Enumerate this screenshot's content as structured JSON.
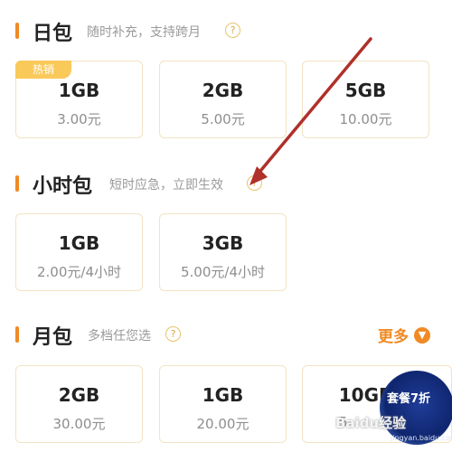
{
  "daily": {
    "title": "日包",
    "subtitle": "随时补充，支持跨月",
    "help": "?",
    "cards": [
      {
        "tag": "热销",
        "size": "1GB",
        "price": "3.00元"
      },
      {
        "size": "2GB",
        "price": "5.00元"
      },
      {
        "size": "5GB",
        "price": "10.00元"
      }
    ]
  },
  "hourly": {
    "title": "小时包",
    "subtitle": "短时应急，立即生效",
    "help": "?",
    "cards": [
      {
        "size": "1GB",
        "price": "2.00元/4小时"
      },
      {
        "size": "3GB",
        "price": "5.00元/4小时"
      }
    ]
  },
  "monthly": {
    "title": "月包",
    "subtitle": "多档任您选",
    "help": "?",
    "more": "更多",
    "cards": [
      {
        "size": "2GB",
        "price": "30.00元"
      },
      {
        "size": "1GB",
        "price": "20.00元"
      },
      {
        "size": "10GB",
        "price": "5"
      }
    ]
  },
  "promo_badge": "套餐7折",
  "watermark": {
    "logo": "Baidu经验",
    "url": "jingyan.baidu.com"
  },
  "colors": {
    "accent": "#f08a24",
    "hot_tag": "#f9c95a",
    "arrow": "#b0302a"
  }
}
